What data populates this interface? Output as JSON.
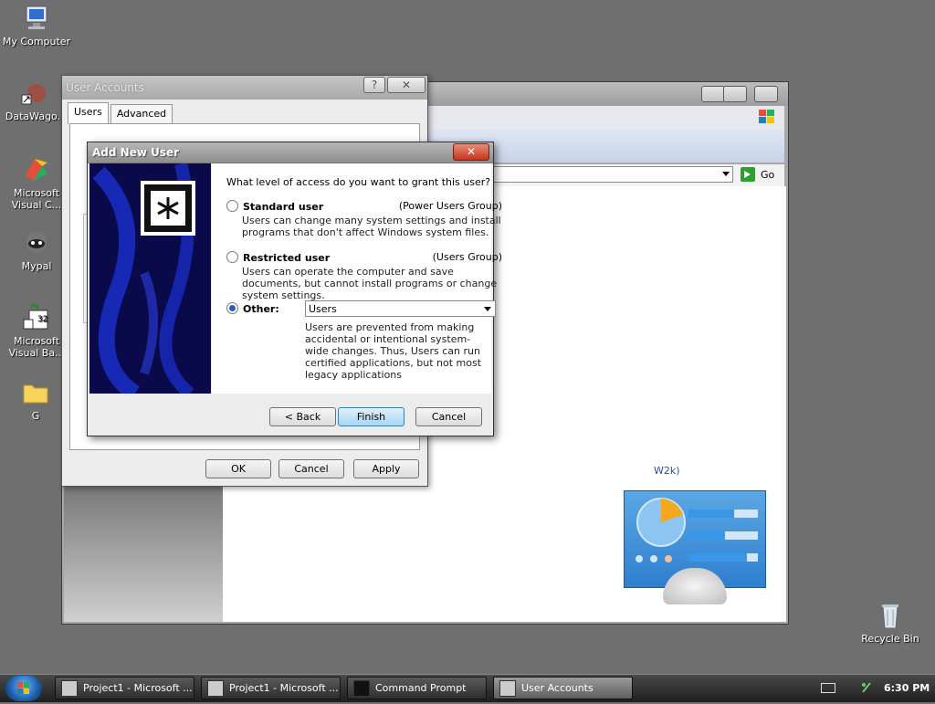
{
  "desktop": {
    "icons": [
      {
        "label": "My Computer"
      },
      {
        "label": "DataWago."
      },
      {
        "label": "Microsoft Visual C..."
      },
      {
        "label": "Mypal"
      },
      {
        "label": "Microsoft Visual Ba..."
      },
      {
        "label": "G"
      },
      {
        "label": "Recycle Bin"
      }
    ]
  },
  "bg_window": {
    "go_label": "Go",
    "w2k_text": "W2k)"
  },
  "user_accounts": {
    "title": "User Accounts",
    "help_glyph": "?",
    "close_glyph": "✕",
    "tabs": [
      {
        "label": "Users"
      },
      {
        "label": "Advanced"
      }
    ],
    "ok_label": "OK",
    "cancel_label": "Cancel",
    "apply_label": "Apply"
  },
  "add_new_user": {
    "title": "Add New User",
    "close_glyph": "✕",
    "question": "What level of access do you want to grant this user?",
    "standard": {
      "label": "Standard user",
      "group": "(Power Users Group)",
      "desc": "Users can change many system settings and install programs that don't affect Windows system files."
    },
    "restricted": {
      "label": "Restricted user",
      "group": "(Users Group)",
      "desc": "Users can operate the computer and save documents, but cannot install programs or change system settings."
    },
    "other": {
      "label": "Other:",
      "selected": "Users",
      "desc": "Users are prevented from making accidental or intentional system-wide changes.  Thus, Users can run certified applications, but not most legacy applications"
    },
    "back_label": "< Back",
    "finish_label": "Finish",
    "cancel_label": "Cancel"
  },
  "taskbar": {
    "tasks": [
      {
        "label": "Project1 - Microsoft ..."
      },
      {
        "label": "Project1 - Microsoft ..."
      },
      {
        "label": "Command Prompt"
      },
      {
        "label": "User Accounts"
      }
    ],
    "clock": "6:30 PM"
  }
}
